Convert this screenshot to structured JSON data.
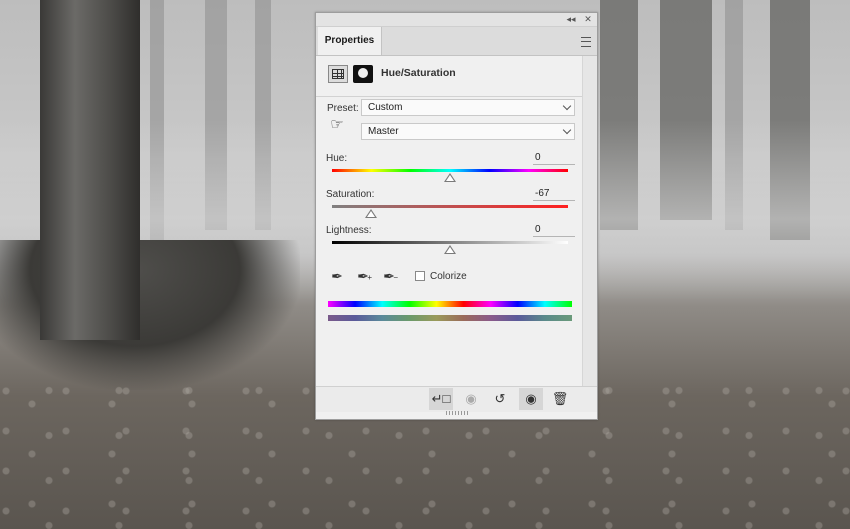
{
  "panel": {
    "tab_label": "Properties",
    "collapse_glyph": "◂◂",
    "close_glyph": "✕",
    "header_title": "Hue/Saturation",
    "preset_label": "Preset:",
    "preset_value": "Custom",
    "channel_value": "Master",
    "hue": {
      "label": "Hue:",
      "value": "0",
      "slider_fraction": 0.5
    },
    "saturation": {
      "label": "Saturation:",
      "value": "-67",
      "slider_fraction": 0.165
    },
    "lightness": {
      "label": "Lightness:",
      "value": "0",
      "slider_fraction": 0.5
    },
    "colorize_label": "Colorize",
    "colorize_checked": false
  },
  "icons": {
    "hand_tool": "targeted-adjustment-hand-icon",
    "eyedropper": "eyedropper-icon",
    "eyedropper_add": "eyedropper-add-icon",
    "eyedropper_subtract": "eyedropper-subtract-icon",
    "clip": "clip-to-layer-icon",
    "view_previous": "view-previous-state-icon",
    "reset": "reset-icon",
    "visibility": "eye-icon",
    "delete": "trash-icon"
  }
}
